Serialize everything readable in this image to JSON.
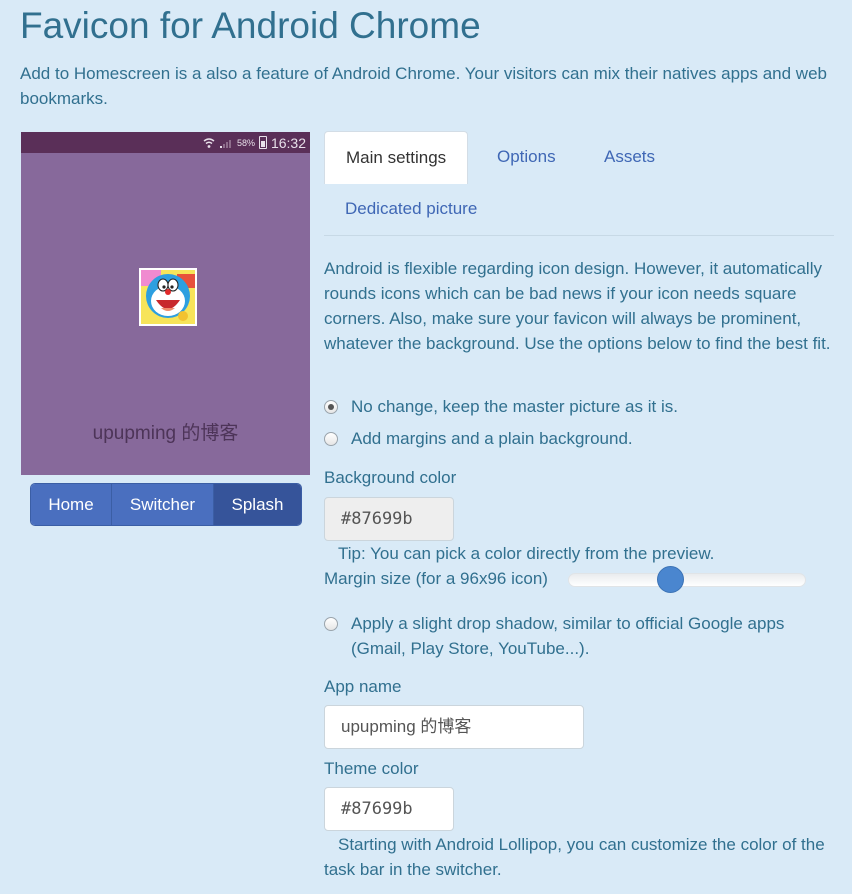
{
  "page": {
    "title": "Favicon for Android Chrome",
    "intro": "Add to Homescreen is a also a feature of Android Chrome. Your visitors can mix their natives apps and web bookmarks."
  },
  "preview": {
    "status_battery": "58%",
    "status_time": "16:32",
    "app_name": "upupming 的博客",
    "background_color": "#87699b",
    "statusbar_color": "#5a2f58",
    "buttons": [
      "Home",
      "Switcher",
      "Splash"
    ],
    "active_button": "Splash"
  },
  "tabs": [
    "Main settings",
    "Options",
    "Assets",
    "Dedicated picture"
  ],
  "active_tab": "Main settings",
  "settings": {
    "description": "Android is flexible regarding icon design. However, it automatically rounds icons which can be bad news if your icon needs square corners. Also, make sure your favicon will always be prominent, whatever the background. Use the options below to find the best fit.",
    "radio_no_change": "No change, keep the master picture as it is.",
    "radio_margins": "Add margins and a plain background.",
    "selected_radio": "No change, keep the master picture as it is.",
    "bg_color_label": "Background color",
    "bg_color_value": "#87699b",
    "tip": "Tip: You can pick a color directly from the preview.",
    "margin_label": "Margin size (for a 96x96 icon)",
    "margin_slider_fraction": 0.42,
    "shadow_label": "Apply a slight drop shadow, similar to official Google apps (Gmail, Play Store, YouTube...).",
    "shadow_checked": false,
    "app_name_label": "App name",
    "app_name_value": "upupming 的博客",
    "theme_color_label": "Theme color",
    "theme_color_value": "#87699b",
    "theme_note": "Starting with Android Lollipop, you can customize the color of the task bar in the switcher."
  },
  "colors": {
    "accent": "#31708f",
    "link": "#3f67b5",
    "button": "#4a6fbf",
    "slider_thumb": "#4a86cf"
  }
}
